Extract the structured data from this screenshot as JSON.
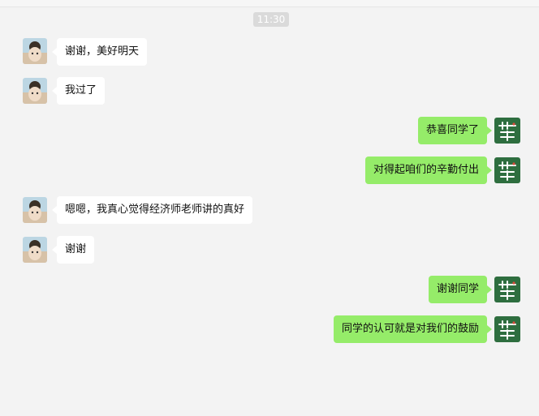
{
  "time_divider": "11:30",
  "messages": [
    {
      "side": "left",
      "text": "谢谢，美好明天"
    },
    {
      "side": "left",
      "text": "我过了"
    },
    {
      "side": "right",
      "text": "恭喜同学了"
    },
    {
      "side": "right",
      "text": "对得起咱们的辛勤付出"
    },
    {
      "side": "left",
      "text": "嗯嗯，我真心觉得经济师老师讲的真好"
    },
    {
      "side": "left",
      "text": "谢谢"
    },
    {
      "side": "right",
      "text": "谢谢同学"
    },
    {
      "side": "right",
      "text": "同学的认可就是对我们的鼓励"
    }
  ],
  "colors": {
    "background": "#f3f3f3",
    "bubble_self": "#95ec69",
    "bubble_other": "#ffffff",
    "time_badge": "#dadada",
    "avatar_self_bg": "#2e6e3f"
  }
}
